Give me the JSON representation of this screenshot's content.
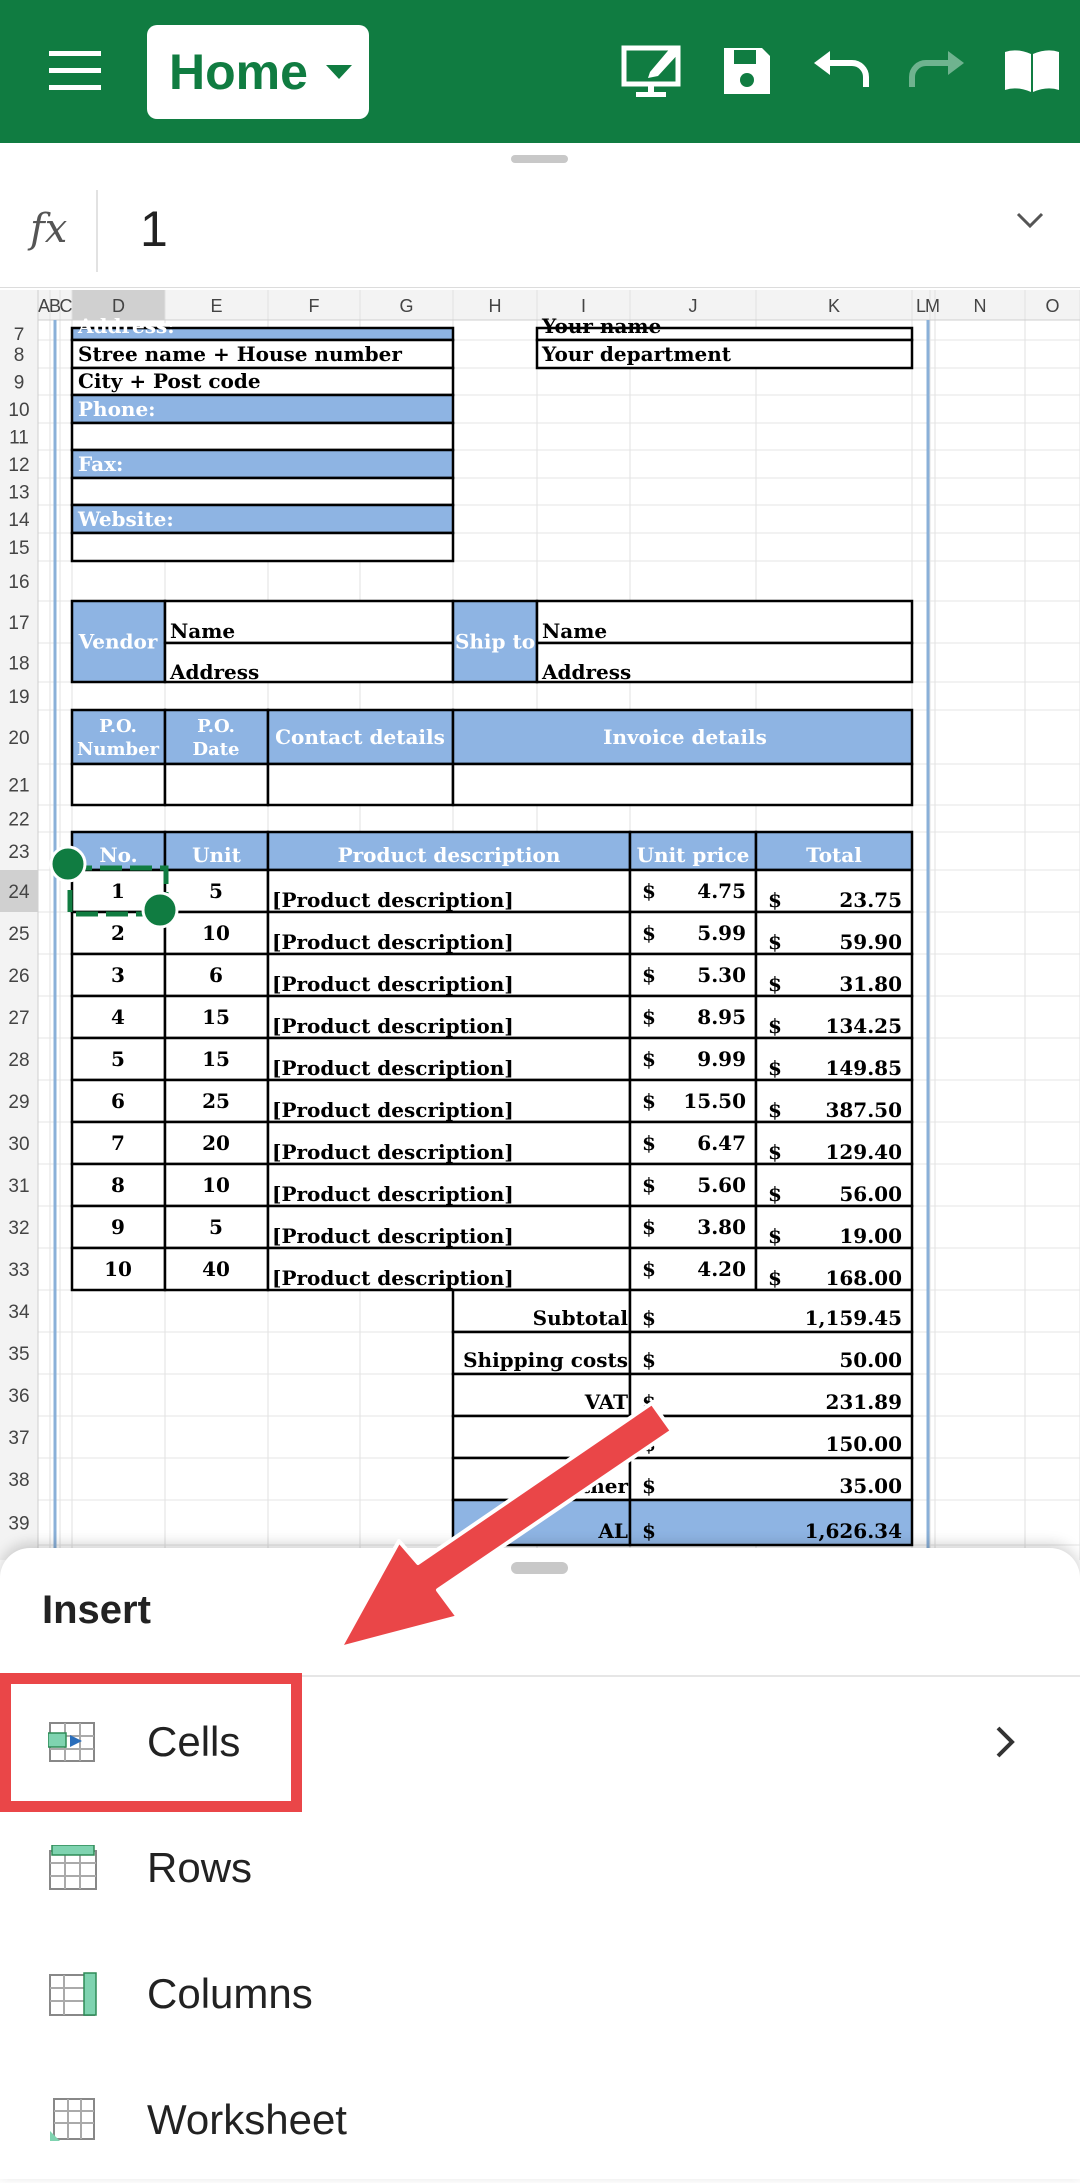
{
  "topbar": {
    "menu_icon": "hamburger-icon",
    "home_label": "Home",
    "icons": [
      "present-icon",
      "save-icon",
      "undo-icon",
      "redo-icon",
      "reader-icon"
    ]
  },
  "formula": {
    "fx": "fx",
    "value": "1"
  },
  "sheet": {
    "columns": [
      "A",
      "B",
      "C",
      "D",
      "E",
      "F",
      "G",
      "H",
      "I",
      "J",
      "K",
      "L",
      "M",
      "N",
      "O"
    ],
    "rows": [
      "7",
      "8",
      "9",
      "10",
      "11",
      "12",
      "13",
      "14",
      "15",
      "16",
      "17",
      "18",
      "19",
      "20",
      "21",
      "22",
      "23",
      "24",
      "25",
      "26",
      "27",
      "28",
      "29",
      "30",
      "31",
      "32",
      "33",
      "34",
      "35",
      "36",
      "37",
      "38",
      "39"
    ],
    "company": {
      "address": "Address:",
      "street": "Stree name + House number",
      "city": "City + Post code",
      "phone": "Phone:",
      "fax": "Fax:",
      "website": "Website:"
    },
    "contact": {
      "name": "Your name",
      "dept": "Your department"
    },
    "vendor": {
      "label": "Vendor",
      "name": "Name",
      "address": "Address"
    },
    "shipto": {
      "label": "Ship to",
      "name": "Name",
      "address": "Address"
    },
    "po_header": {
      "number": "P.O. Number",
      "date": "P.O. Date",
      "contact": "Contact details",
      "invoice": "Invoice details"
    },
    "items_header": {
      "no": "No.",
      "unit": "Unit",
      "desc": "Product description",
      "price": "Unit price",
      "total": "Total"
    },
    "items": [
      {
        "no": "1",
        "unit": "5",
        "desc": "[Product description]",
        "price": "4.75",
        "total": "23.75"
      },
      {
        "no": "2",
        "unit": "10",
        "desc": "[Product description]",
        "price": "5.99",
        "total": "59.90"
      },
      {
        "no": "3",
        "unit": "6",
        "desc": "[Product description]",
        "price": "5.30",
        "total": "31.80"
      },
      {
        "no": "4",
        "unit": "15",
        "desc": "[Product description]",
        "price": "8.95",
        "total": "134.25"
      },
      {
        "no": "5",
        "unit": "15",
        "desc": "[Product description]",
        "price": "9.99",
        "total": "149.85"
      },
      {
        "no": "6",
        "unit": "25",
        "desc": "[Product description]",
        "price": "15.50",
        "total": "387.50"
      },
      {
        "no": "7",
        "unit": "20",
        "desc": "[Product description]",
        "price": "6.47",
        "total": "129.40"
      },
      {
        "no": "8",
        "unit": "10",
        "desc": "[Product description]",
        "price": "5.60",
        "total": "56.00"
      },
      {
        "no": "9",
        "unit": "5",
        "desc": "[Product description]",
        "price": "3.80",
        "total": "19.00"
      },
      {
        "no": "10",
        "unit": "40",
        "desc": "[Product description]",
        "price": "4.20",
        "total": "168.00"
      }
    ],
    "currency": "$",
    "summary": [
      {
        "label": "Subtotal",
        "value": "1,159.45"
      },
      {
        "label": "Shipping costs",
        "value": "50.00"
      },
      {
        "label": "VAT",
        "value": "231.89"
      },
      {
        "label": "",
        "value": "150.00"
      },
      {
        "label": "ther",
        "value": "35.00"
      },
      {
        "label": "AL",
        "value": "1,626.34"
      }
    ]
  },
  "insert_panel": {
    "title": "Insert",
    "items": [
      {
        "label": "Cells",
        "icon": "insert-cells-icon"
      },
      {
        "label": "Rows",
        "icon": "insert-rows-icon"
      },
      {
        "label": "Columns",
        "icon": "insert-columns-icon"
      },
      {
        "label": "Worksheet",
        "icon": "insert-worksheet-icon"
      }
    ]
  },
  "colors": {
    "brand": "#107c41",
    "header_blue": "#8eb4e3",
    "highlight": "#ea4648"
  }
}
